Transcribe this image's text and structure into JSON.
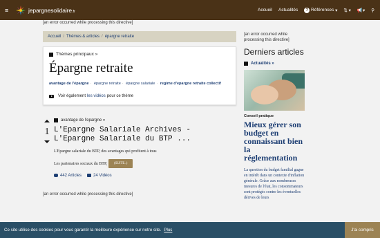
{
  "header": {
    "brand_main": "jepargnesolidaire",
    "brand_tld": ".fr",
    "nav": [
      {
        "label": "Accueil"
      },
      {
        "label": "Actualités"
      },
      {
        "label": "Références"
      }
    ]
  },
  "main": {
    "error_top": "[an error occurred while processing this directive]",
    "breadcrumb": [
      "Accueil",
      "Thèmes & articles",
      "épargne retraite"
    ],
    "card": {
      "theme_label": "Thèmes principaux »",
      "title": "Épargne retraite",
      "tags": [
        {
          "text": "avantage de l'épargne",
          "bold": true
        },
        {
          "text": "épargne retraite",
          "bold": false
        },
        {
          "text": "épargne salariale",
          "bold": false
        },
        {
          "text": "regime d'epargne retraite collectif",
          "bold": true
        }
      ],
      "see_also_prefix": "Voir également",
      "see_also_link": "les vidéos",
      "see_also_suffix": "pour ce thème"
    },
    "article": {
      "votes": "1",
      "category": "avantage de l'epargne »",
      "title": "L'Epargne Salariale Archives - L'Epargne Salariale du BTP ...",
      "excerpt": "L'Epargne salariale du BTP, des avantages qui profitent à tous",
      "partners_text": "Les partenaires sociaux du BTP,",
      "button": "(SUITE..)",
      "stats": [
        {
          "count": "442 Articles"
        },
        {
          "count": "24 Vidéos"
        }
      ]
    },
    "error_bottom": "[an error occurred while processing this directive]"
  },
  "sidebar": {
    "error": "[an error occurred while processing this directive]",
    "heading": "Derniers articles",
    "category": "Actualités »",
    "photo_icon": "hands-photo",
    "post_category": "Conseil pratique",
    "post_title": "Mieux gérer son budget en connaissant bien la réglementation",
    "post_text": "La question du budget familial gagne en intérêt dans un contexte d'inflation générale. Grâce aux nombreuses mesures de l'état, les consommateurs sont protégés contre les éventuelles dérives de leurs"
  },
  "cookie": {
    "text": "Ce site utilise des cookies pour vous garantir la meilleure expérience sur notre site.",
    "link": "Plus",
    "button": "J'ai compris"
  },
  "colors": {
    "topbar": "#4a3217",
    "accent": "#9c8354",
    "link": "#1d3e73",
    "cookie_bar": "#2a4f66"
  }
}
